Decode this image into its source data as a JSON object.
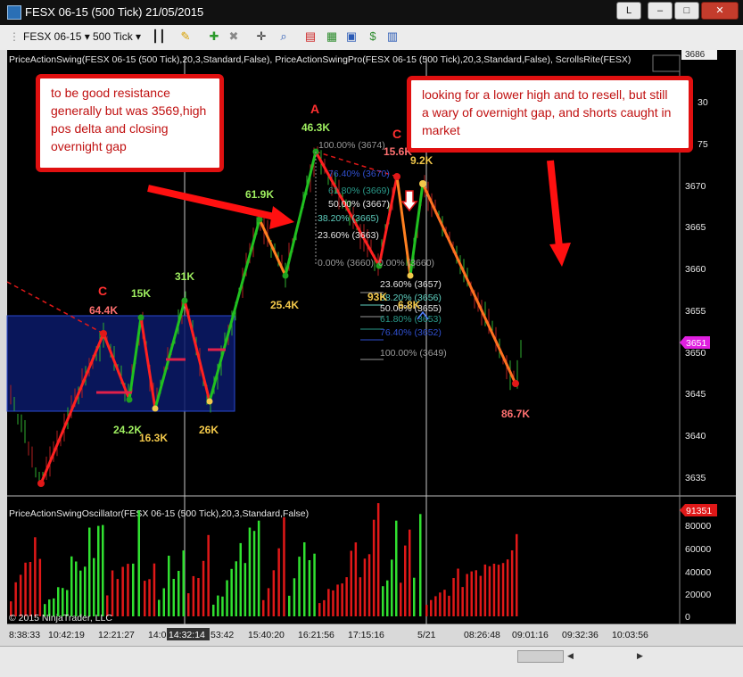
{
  "window": {
    "title": "FESX 06-15 (500 Tick)  21/05/2015",
    "buttons": {
      "link": "L",
      "minimize": "–",
      "maximize": "□",
      "close": "✕"
    }
  },
  "toolbar": {
    "instrument": "FESX 06-15",
    "interval": "500 Tick"
  },
  "price_panel": {
    "indicator_label": "PriceActionSwing(FESX 06-15 (500 Tick),20,3,Standard,False), PriceActionSwingPro(FESX 06-15 (500 Tick),20,3,Standard,False), ScrollsRite(FESX)",
    "top_label": "3686",
    "y_ticks": [
      "30",
      "75",
      "3670",
      "3665",
      "3660",
      "3655",
      "3650",
      "3645",
      "3640",
      "3635"
    ],
    "last_price_tag": "3651",
    "swing_labels": [
      {
        "text": "C",
        "color": "#ff3030"
      },
      {
        "text": "64.4K",
        "color": "#ff7070"
      },
      {
        "text": "15K",
        "color": "#9fef60"
      },
      {
        "text": "31K",
        "color": "#9fef60"
      },
      {
        "text": "24.2K",
        "color": "#9fef60"
      },
      {
        "text": "16.3K",
        "color": "#f2c84a"
      },
      {
        "text": "26K",
        "color": "#f2c84a"
      },
      {
        "text": "61.9K",
        "color": "#9fef60"
      },
      {
        "text": "25.4K",
        "color": "#f2c84a"
      },
      {
        "text": "A",
        "color": "#ff3030"
      },
      {
        "text": "46.3K",
        "color": "#9fef60"
      },
      {
        "text": "C",
        "color": "#ff3030"
      },
      {
        "text": "15.6K",
        "color": "#ff7070"
      },
      {
        "text": "9.2K",
        "color": "#f2c84a"
      },
      {
        "text": "93K",
        "color": "#f2c84a"
      },
      {
        "text": "6.8K",
        "color": "#f2c84a"
      },
      {
        "text": "86.7K",
        "color": "#ff7070"
      }
    ],
    "fib_upper": [
      {
        "text": "100.00% (3674)",
        "color": "#9a9a9a"
      },
      {
        "text": "76.40% (3670)",
        "color": "#3050d0"
      },
      {
        "text": "61.80% (3669)",
        "color": "#2a9a8a"
      },
      {
        "text": "50.00% (3667)",
        "color": "#e6e6e6"
      },
      {
        "text": "38.20% (3665)",
        "color": "#5fd0c0"
      },
      {
        "text": "23.60% (3663)",
        "color": "#e6e6e6"
      },
      {
        "text": "0.00% (3660)",
        "color": "#9a9a9a"
      },
      {
        "text": "0.00% (3660)",
        "color": "#9a9a9a"
      }
    ],
    "fib_lower": [
      {
        "text": "23.60% (3657)",
        "color": "#e6e6e6"
      },
      {
        "text": "38.20% (3656)",
        "color": "#5fd0c0"
      },
      {
        "text": "50.00% (3655)",
        "color": "#e6e6e6"
      },
      {
        "text": "61.80% (3653)",
        "color": "#2a9a8a"
      },
      {
        "text": "76.40% (3652)",
        "color": "#3050d0"
      },
      {
        "text": "100.00% (3649)",
        "color": "#9a9a9a"
      }
    ]
  },
  "oscillator_panel": {
    "label": "PriceActionSwingOscillator(FESX 06-15 (500 Tick),20,3,Standard,False)",
    "y_ticks": [
      "80000",
      "60000",
      "40000",
      "20000",
      "0"
    ],
    "last_value_tag": "91351",
    "copyright": "© 2015 NinjaTrader, LLC"
  },
  "x_axis": {
    "labels": [
      "8:38:33",
      "10:42:19",
      "12:21:27",
      "14:0",
      "14:32:14",
      "53:42",
      "15:40:20",
      "16:21:56",
      "17:15:16",
      "5/21",
      "08:26:48",
      "09:01:16",
      "09:32:36",
      "10:03:56"
    ]
  },
  "annotations": [
    {
      "text": "to be good resistance generally but was 3569,high pos delta and closing overnight gap"
    },
    {
      "text": "looking for a lower high and to resell, but still a wary of overnight gap, and shorts caught in market"
    }
  ]
}
